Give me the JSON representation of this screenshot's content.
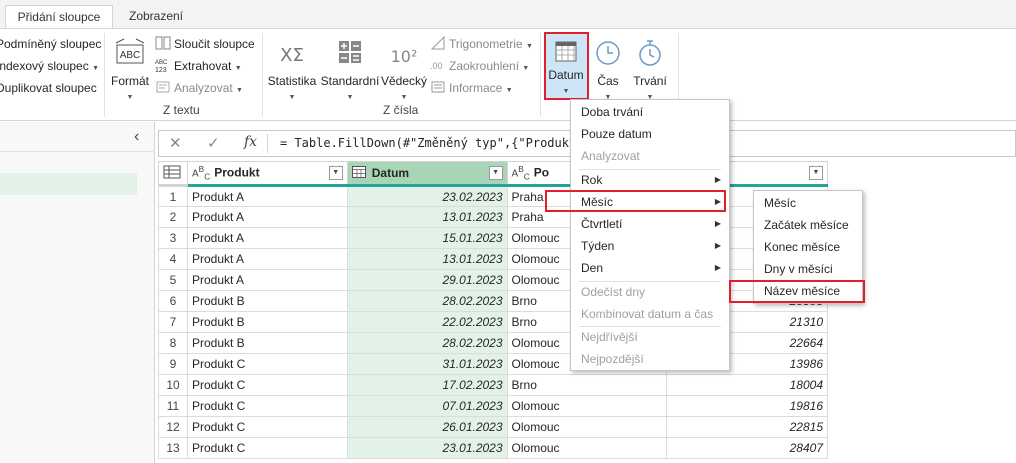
{
  "tabs": [
    "Přidání sloupce",
    "Zobrazení"
  ],
  "ribbon": {
    "general": [
      "Podmíněný sloupec",
      "Indexový sloupec",
      "Duplikovat sloupec"
    ],
    "format_label": "Formát",
    "text_items": [
      "Sloučit sloupce",
      "Extrahovat",
      "Analyzovat"
    ],
    "text_group": "Z textu",
    "stat_label": "Statistika",
    "std_label": "Standardní",
    "sci_label": "Vědecký",
    "num_items": [
      "Trigonometrie",
      "Zaokrouhlení",
      "Informace"
    ],
    "num_group": "Z čísla",
    "datum_label": "Datum",
    "cas_label": "Čas",
    "trvani_label": "Trvání",
    "abc_glyph": "ABC",
    "abc123_glyph": "ABC\n123",
    "sigma_glyph": "XΣ",
    "pow_glyph": "10²"
  },
  "formula": {
    "cancel": "✕",
    "confirm": "✓",
    "fx": "fx",
    "text": "= Table.FillDown(#\"Změněný typ\",{\"Produkt"
  },
  "columns": [
    {
      "name": "Produkt",
      "type": "ABC"
    },
    {
      "name": "Datum",
      "type": "cal"
    },
    {
      "name": "Po",
      "type": "ABC"
    },
    {
      "name": "",
      "type": ""
    }
  ],
  "rows": [
    {
      "n": "1",
      "produkt": "Produkt A",
      "datum": "23.02.2023",
      "pobocka": "Praha",
      "num": ""
    },
    {
      "n": "2",
      "produkt": "Produkt A",
      "datum": "13.01.2023",
      "pobocka": "Praha",
      "num": ""
    },
    {
      "n": "3",
      "produkt": "Produkt A",
      "datum": "15.01.2023",
      "pobocka": "Olomouc",
      "num": ""
    },
    {
      "n": "4",
      "produkt": "Produkt A",
      "datum": "13.01.2023",
      "pobocka": "Olomouc",
      "num": ""
    },
    {
      "n": "5",
      "produkt": "Produkt A",
      "datum": "29.01.2023",
      "pobocka": "Olomouc",
      "num": ""
    },
    {
      "n": "6",
      "produkt": "Produkt B",
      "datum": "28.02.2023",
      "pobocka": "Brno",
      "num": "23583"
    },
    {
      "n": "7",
      "produkt": "Produkt B",
      "datum": "22.02.2023",
      "pobocka": "Brno",
      "num": "21310"
    },
    {
      "n": "8",
      "produkt": "Produkt B",
      "datum": "28.02.2023",
      "pobocka": "Olomouc",
      "num": "22664"
    },
    {
      "n": "9",
      "produkt": "Produkt C",
      "datum": "31.01.2023",
      "pobocka": "Olomouc",
      "num": "13986"
    },
    {
      "n": "10",
      "produkt": "Produkt C",
      "datum": "17.02.2023",
      "pobocka": "Brno",
      "num": "18004"
    },
    {
      "n": "11",
      "produkt": "Produkt C",
      "datum": "07.01.2023",
      "pobocka": "Olomouc",
      "num": "19816"
    },
    {
      "n": "12",
      "produkt": "Produkt C",
      "datum": "26.01.2023",
      "pobocka": "Olomouc",
      "num": "22815"
    },
    {
      "n": "13",
      "produkt": "Produkt C",
      "datum": "23.01.2023",
      "pobocka": "Olomouc",
      "num": "28407"
    }
  ],
  "datum_menu": {
    "items": [
      {
        "label": "Doba trvání",
        "enabled": true,
        "submenu": false
      },
      {
        "label": "Pouze datum",
        "enabled": true,
        "submenu": false
      },
      {
        "label": "Analyzovat",
        "enabled": false,
        "submenu": false
      },
      {
        "label": "Rok",
        "enabled": true,
        "submenu": true
      },
      {
        "label": "Měsíc",
        "enabled": true,
        "submenu": true,
        "highlighted": true
      },
      {
        "label": "Čtvrtletí",
        "enabled": true,
        "submenu": true
      },
      {
        "label": "Týden",
        "enabled": true,
        "submenu": true
      },
      {
        "label": "Den",
        "enabled": true,
        "submenu": true
      },
      {
        "label": "Odečíst dny",
        "enabled": false,
        "submenu": false
      },
      {
        "label": "Kombinovat datum a čas",
        "enabled": false,
        "submenu": false
      },
      {
        "label": "Nejdřívější",
        "enabled": false,
        "submenu": false
      },
      {
        "label": "Nejpozdější",
        "enabled": false,
        "submenu": false
      }
    ]
  },
  "mesic_menu": {
    "items": [
      "Měsíc",
      "Začátek měsíce",
      "Konec měsíce",
      "Dny v měsíci",
      "Název měsíce"
    ],
    "highlighted": "Název měsíce"
  },
  "colors": {
    "accent": "#23a497",
    "selected_column": "#e3f2e8",
    "highlight_box": "#e0202c"
  }
}
